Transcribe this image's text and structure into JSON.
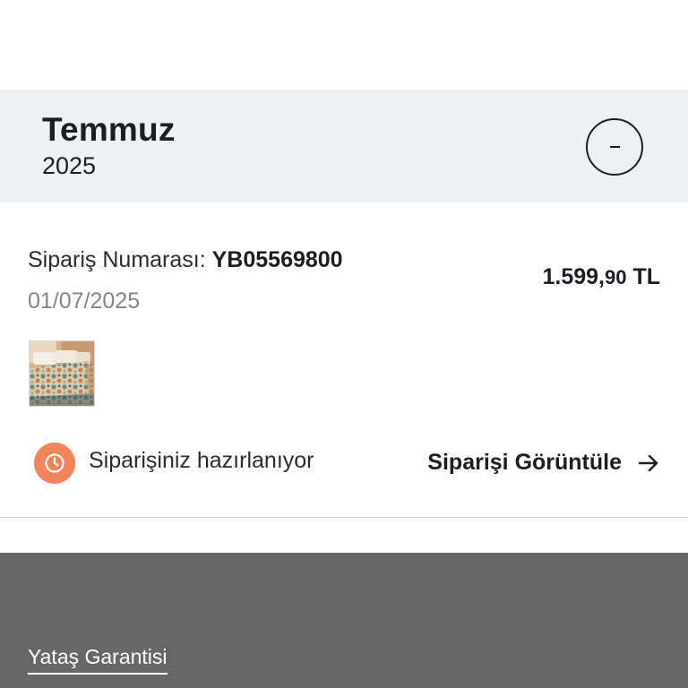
{
  "month_group": {
    "month": "Temmuz",
    "year": "2025",
    "toggle_symbol": "-"
  },
  "order": {
    "number_label": "Sipariş Numarası:",
    "number": "YB05569800",
    "date": "01/07/2025",
    "price_main": "1.599,",
    "price_decimals": "90",
    "price_currency": "TL",
    "status_text": "Siparişiniz hazırlanıyor",
    "view_link": "Siparişi Görüntüle",
    "status_color": "#f2845c"
  },
  "footer": {
    "guarantee_link": "Yataş Garantisi",
    "background": "#676767"
  },
  "icons": {
    "status": "clock-icon",
    "view_arrow": "arrow-right-icon",
    "toggle": "minus-icon"
  }
}
